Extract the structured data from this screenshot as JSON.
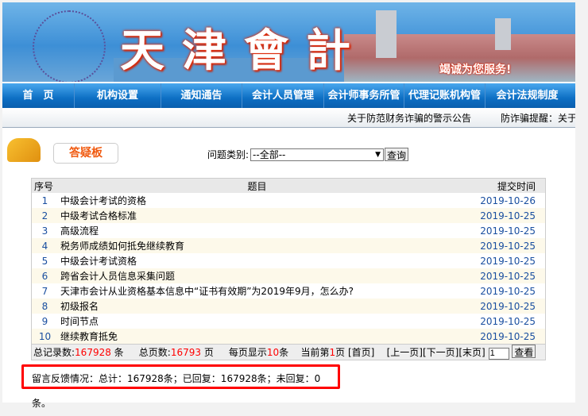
{
  "banner": {
    "title": "天津會計",
    "slogan": "竭诚为您服务!"
  },
  "nav": [
    "首　页",
    "机构设置",
    "通知通告",
    "会计人员管理",
    "会计师事务所管",
    "代理记账机构管",
    "会计法规制度"
  ],
  "marquee": [
    "关于防范财务诈骗的警示公告",
    "防诈骗提醒：关于"
  ],
  "logo": {
    "label": "答疑板"
  },
  "filter": {
    "label": "问题类别:",
    "selected": "--全部--",
    "button": "查询"
  },
  "table": {
    "headers": [
      "序号",
      "题目",
      "提交时间"
    ],
    "rows": [
      [
        "1",
        "中级会计考试的资格",
        "2019-10-26"
      ],
      [
        "2",
        "中级考试合格标准",
        "2019-10-25"
      ],
      [
        "3",
        "高级流程",
        "2019-10-25"
      ],
      [
        "4",
        "税务师成绩如何抵免继续教育",
        "2019-10-25"
      ],
      [
        "5",
        "中级会计考试资格",
        "2019-10-25"
      ],
      [
        "6",
        "跨省会计人员信息采集问题",
        "2019-10-25"
      ],
      [
        "7",
        "天津市会计从业资格基本信息中“证书有效期”为2019年9月，怎么办?",
        "2019-10-25"
      ],
      [
        "8",
        "初级报名",
        "2019-10-25"
      ],
      [
        "9",
        "时间节点",
        "2019-10-25"
      ],
      [
        "10",
        "继续教育抵免",
        "2019-10-25"
      ]
    ]
  },
  "pager": {
    "total_label": "总记录数:",
    "total": "167928",
    "unit1": " 条",
    "pages_label": "总页数:",
    "pages": "16793",
    "unit2": " 页",
    "per_label": "每页显示",
    "per": "10",
    "unit3": "条",
    "cur_label": "当前第",
    "cur": "1",
    "unit4": "页",
    "first": "[首页]",
    "prev": "[上一页]",
    "next": "[下一页]",
    "last": "[末页]",
    "input": "1",
    "go": "查看"
  },
  "summary": "留言反馈情况：总计：167928条；已回复：167928条；未回复：0条。"
}
